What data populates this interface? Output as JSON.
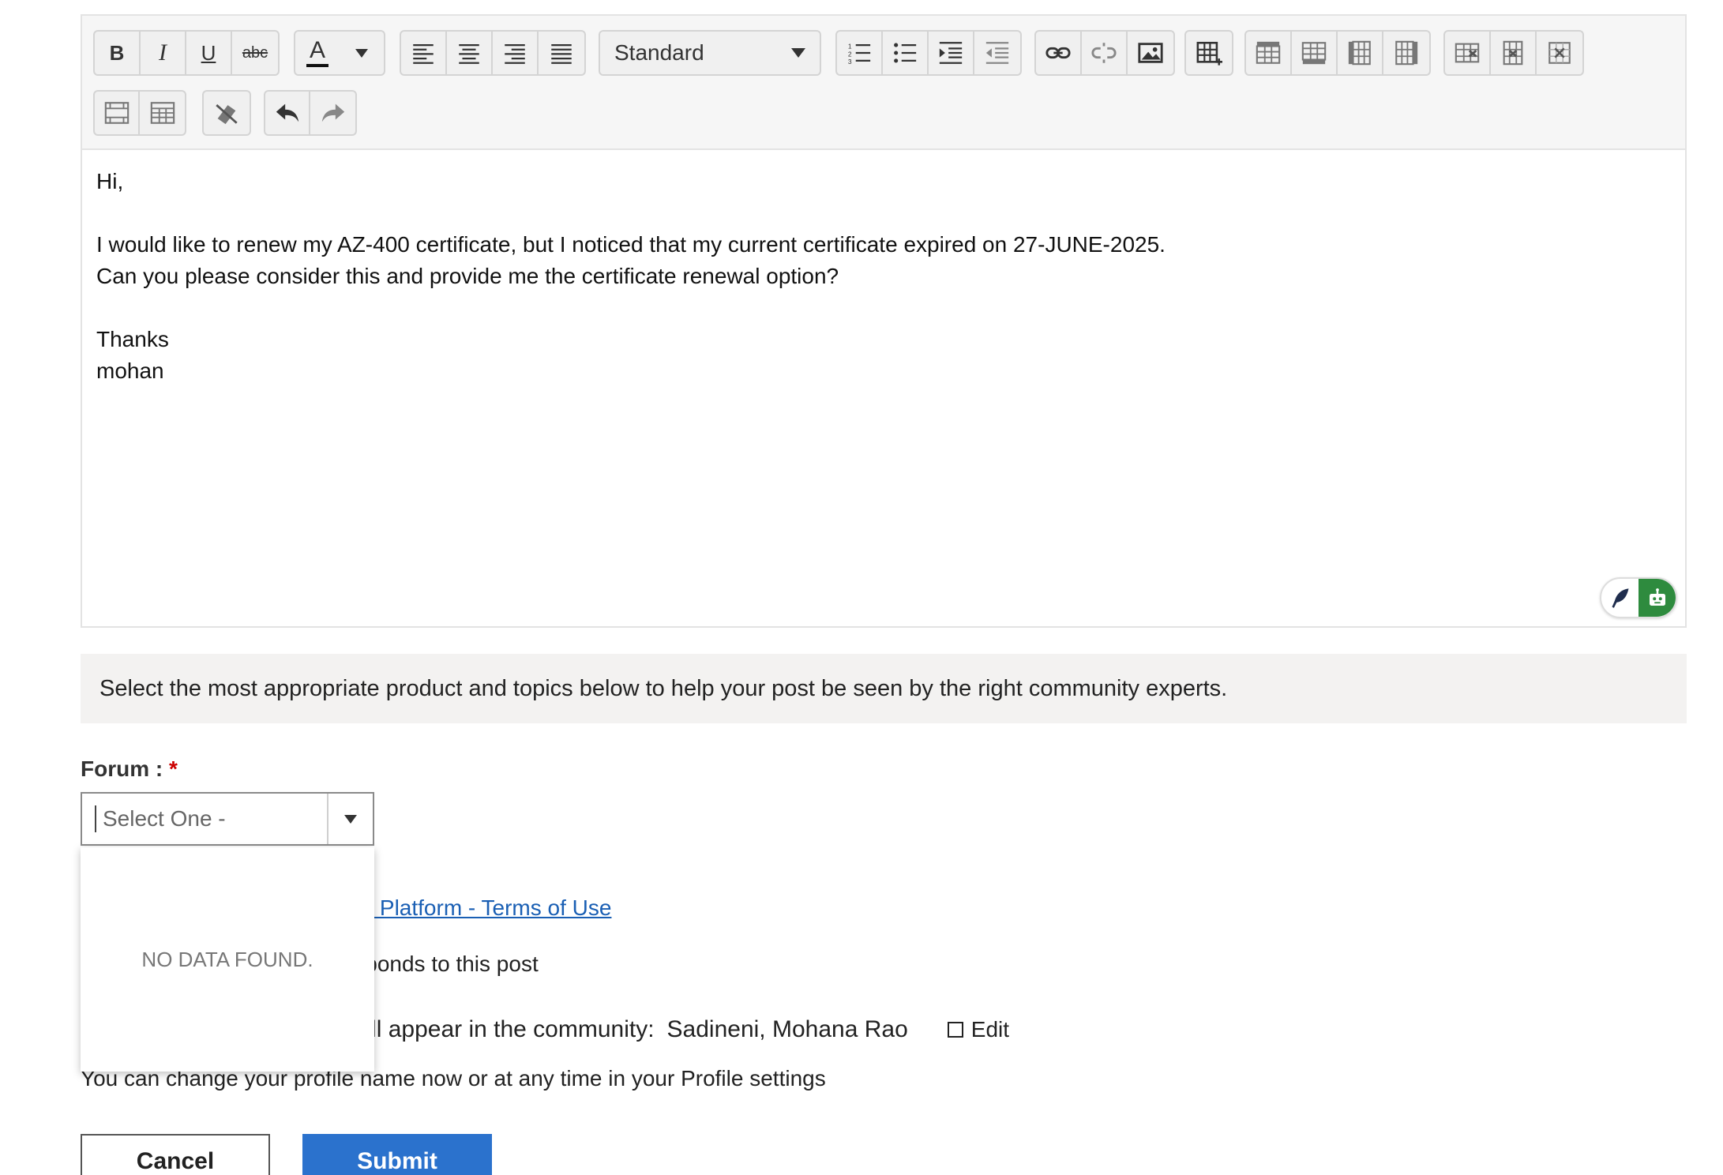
{
  "toolbar": {
    "bold_label": "B",
    "italic_label": "I",
    "underline_label": "U",
    "strike_label": "abc",
    "font_color_label": "A",
    "format_select_value": "Standard"
  },
  "editor": {
    "lines": [
      "Hi,",
      "",
      "I would like to renew my AZ-400 certificate, but I noticed that my current certificate expired on 27-JUNE-2025.",
      "Can you please consider this and provide me the certificate renewal option?",
      "",
      "Thanks",
      "mohan"
    ]
  },
  "info_banner": "Select the most appropriate product and topics below to help your post be seen by the right community experts.",
  "forum": {
    "label": "Forum :",
    "required_mark": "*",
    "select_value": "Select One -",
    "dropdown_empty": "NO DATA FOUND."
  },
  "terms_link": "swers Platform - Terms of Use",
  "notify_text": "e responds to this post",
  "display_name": {
    "prefix": "ne will appear in the community:",
    "name": "Sadineni, Mohana Rao",
    "edit_label": "Edit"
  },
  "profile_note": "You can change your profile name now or at any time in your Profile settings",
  "buttons": {
    "cancel": "Cancel",
    "submit": "Submit"
  },
  "colors": {
    "accent": "#2b72cd",
    "link": "#1a5fb4",
    "ai_green": "#2e8b3e",
    "required": "#cc0000"
  }
}
